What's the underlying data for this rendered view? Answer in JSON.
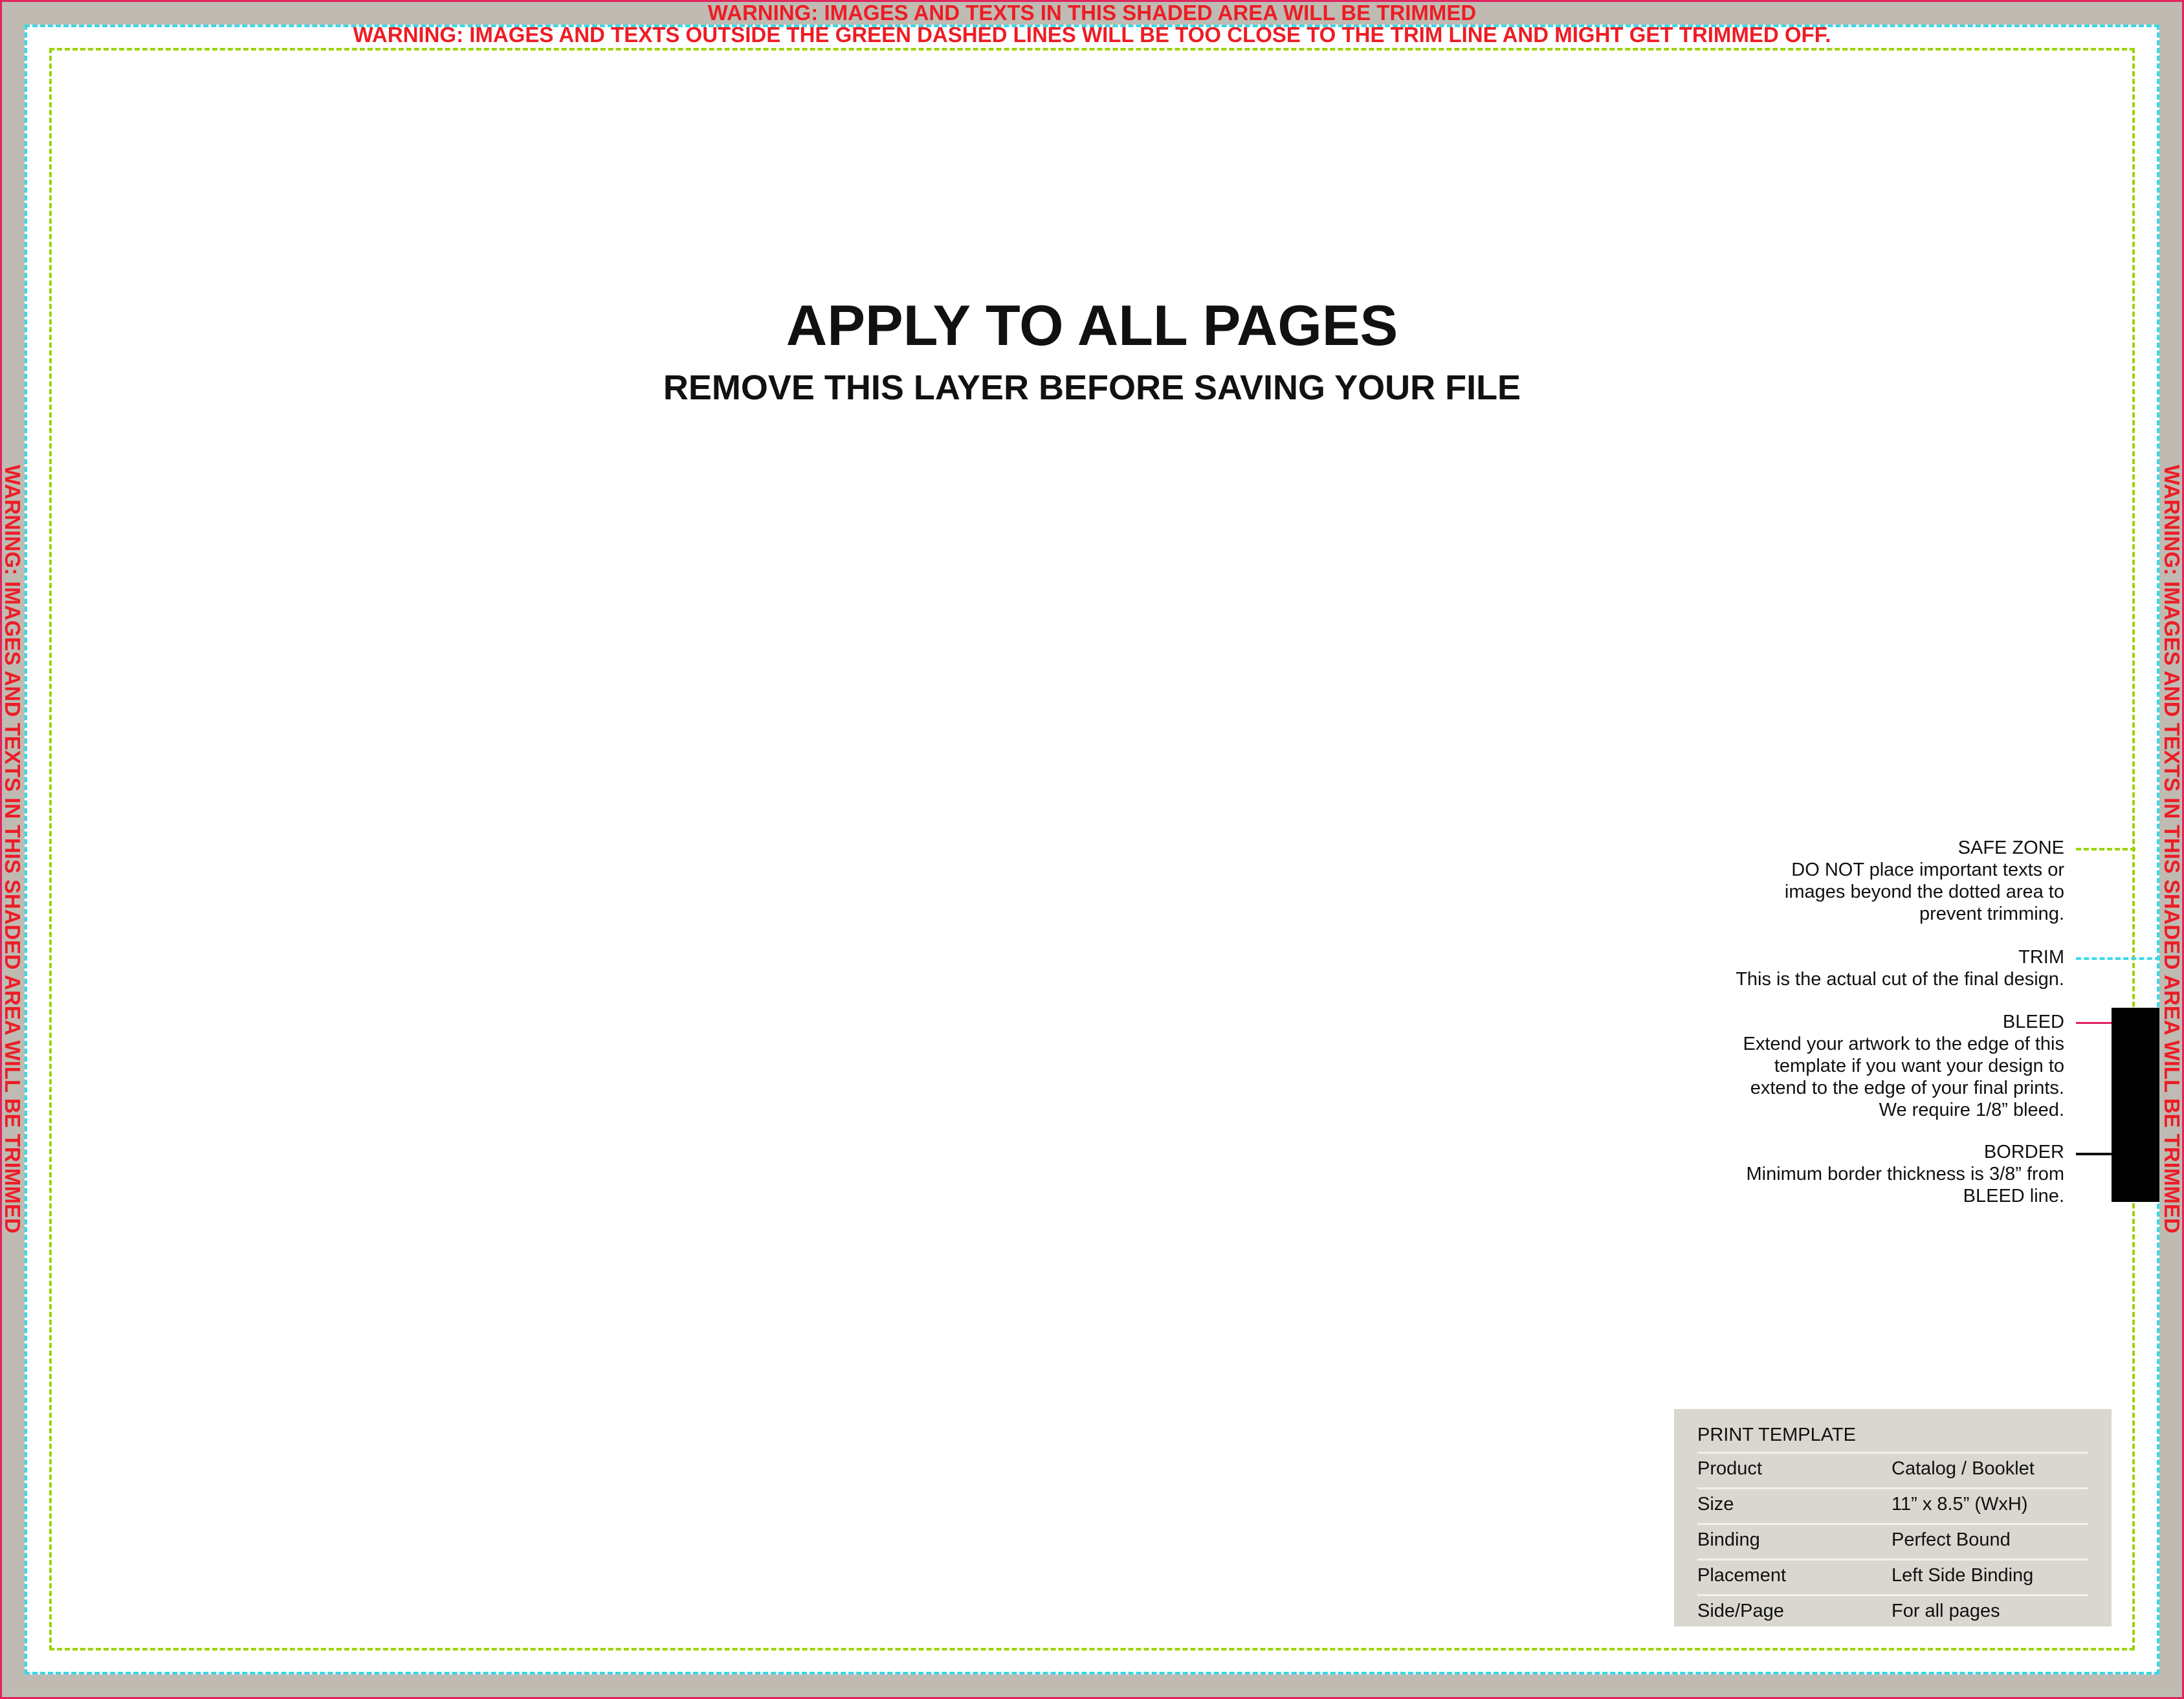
{
  "warnings": {
    "shaded_area": "WARNING: IMAGES AND TEXTS IN THIS SHADED AREA WILL BE TRIMMED",
    "green_lines": "WARNING: IMAGES AND TEXTS OUTSIDE THE GREEN DASHED LINES WILL BE TOO CLOSE TO THE TRIM LINE AND MIGHT GET TRIMMED OFF."
  },
  "heading": {
    "title": "APPLY TO ALL PAGES",
    "subtitle": "REMOVE THIS LAYER BEFORE SAVING YOUR FILE"
  },
  "legend": {
    "safe_zone": {
      "title": "SAFE ZONE",
      "lines": [
        "DO NOT place important texts or",
        "images beyond the dotted area to",
        "prevent trimming."
      ]
    },
    "trim": {
      "title": "TRIM",
      "lines": [
        "This is the actual cut of the final design."
      ]
    },
    "bleed": {
      "title": "BLEED",
      "lines": [
        "Extend your artwork to the edge of this",
        "template if you want your design to",
        "extend to the edge of your final prints.",
        "We require 1/8” bleed."
      ]
    },
    "border": {
      "title": "BORDER",
      "lines": [
        "Minimum border thickness is 3/8” from",
        "BLEED line."
      ]
    }
  },
  "template_info": {
    "heading": "PRINT TEMPLATE",
    "rows": [
      {
        "label": "Product",
        "value": "Catalog / Booklet"
      },
      {
        "label": "Size",
        "value": "11” x 8.5” (WxH)"
      },
      {
        "label": "Binding",
        "value": "Perfect Bound"
      },
      {
        "label": "Placement",
        "value": "Left Side Binding"
      },
      {
        "label": "Side/Page",
        "value": "For all pages"
      }
    ]
  },
  "colors": {
    "warning": "#ee1c25",
    "safe_zone": "#9ad400",
    "trim": "#38d8e6",
    "bleed": "#e0245e",
    "shaded_area": "#bfbbb3",
    "template_box": "#d9d7cf"
  }
}
